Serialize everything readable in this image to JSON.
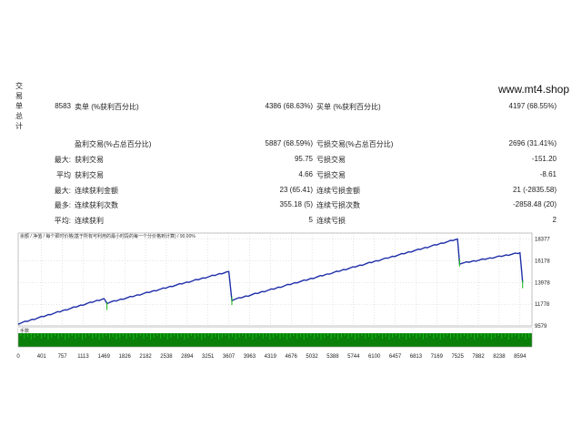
{
  "side_label_chars": [
    "交",
    "易",
    "单",
    "总",
    "计"
  ],
  "site": "www.mt4.shop",
  "rows": [
    {
      "c1": "8583",
      "c2": "卖单 (%获利百分比)",
      "c3": "4386 (68.63%)",
      "c4": "买单 (%获利百分比)",
      "c5": "4197 (68.55%)"
    },
    {
      "c1": "",
      "c2": "盈利交易(%占总百分比)",
      "c3": "5887 (68.59%)",
      "c4": "亏损交易(%占总百分比)",
      "c5": "2696 (31.41%)"
    },
    {
      "c1": "最大:",
      "c2": "获利交易",
      "c3": "95.75",
      "c4": "亏损交易",
      "c5": "-151.20"
    },
    {
      "c1": "平均",
      "c2": "获利交易",
      "c3": "4.66",
      "c4": "亏损交易",
      "c5": "-8.61"
    },
    {
      "c1": "最大:",
      "c2": "连续获利金额",
      "c3": "23 (65.41)",
      "c4": "连续亏损金额",
      "c5": "21 (-2835.58)"
    },
    {
      "c1": "最多:",
      "c2": "连续获利次数",
      "c3": "355.18 (5)",
      "c4": "连续亏损次数",
      "c5": "-2858.48 (20)"
    },
    {
      "c1": "平均:",
      "c2": "连续获利",
      "c3": "5",
      "c4": "连续亏损",
      "c5": "2"
    }
  ],
  "chart": {
    "header": "余额 / 净值 / 每个即时价格(基于所有可利用的最小时段的每一个分价格到计算) / 90.00%",
    "volume_label": "手数",
    "colors": {
      "line": "#1f2fa8",
      "volume": "#12b512",
      "volume_bg": "#0a7f0a",
      "grid": "#c8c8c8"
    }
  },
  "chart_data": {
    "type": "line",
    "x": [
      0,
      1469,
      1520,
      3607,
      3660,
      7525,
      7560,
      8594,
      8640
    ],
    "y": [
      9800,
      12350,
      11900,
      15100,
      12200,
      18400,
      15900,
      17000,
      14000
    ],
    "yticks": [
      18377,
      16178,
      13978,
      11778,
      9579
    ],
    "xticks": [
      0,
      401,
      757,
      1113,
      1469,
      1826,
      2182,
      2538,
      2894,
      3251,
      3607,
      3963,
      4319,
      4676,
      5032,
      5388,
      5744,
      6100,
      6457,
      6813,
      7169,
      7525,
      7882,
      8238,
      8594
    ],
    "ylim": [
      9579,
      19000
    ],
    "xlim": [
      0,
      8800
    ]
  }
}
